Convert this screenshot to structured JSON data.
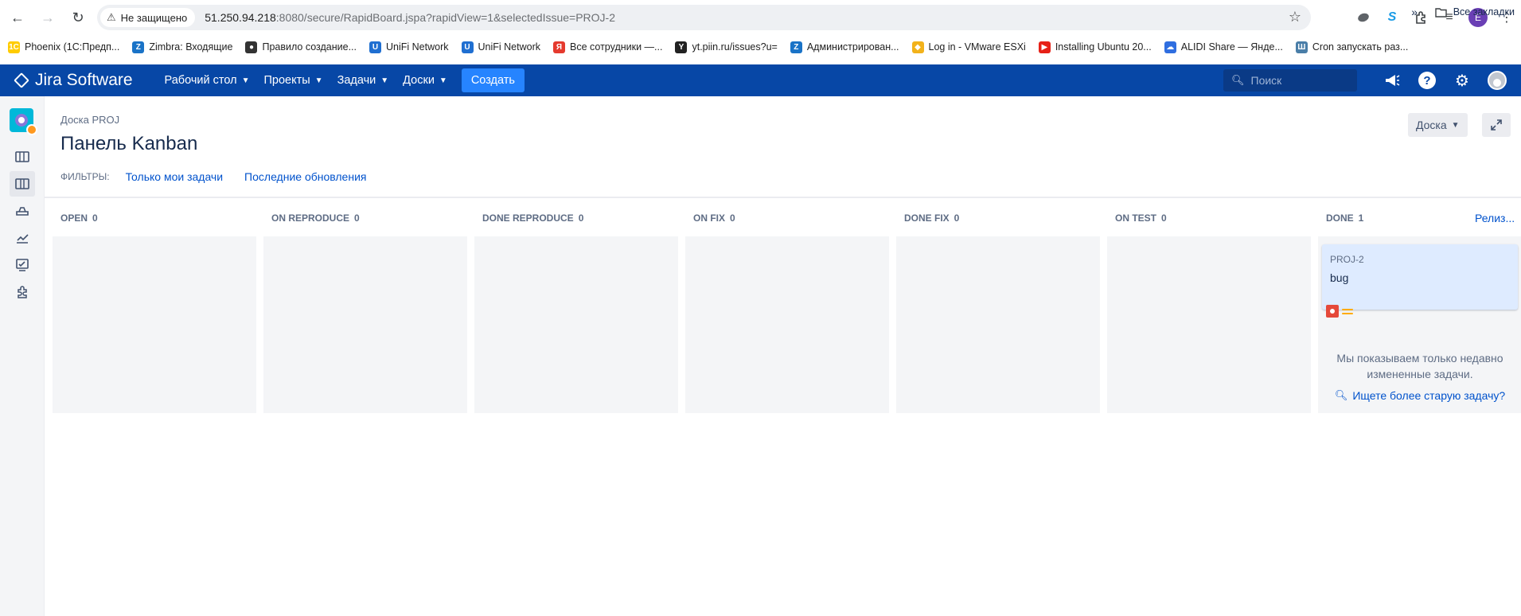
{
  "browser": {
    "security_label": "Не защищено",
    "url_host": "51.250.94.218",
    "url_rest": ":8080/secure/RapidBoard.jspa?rapidView=1&selectedIssue=PROJ-2",
    "profile_letter": "E"
  },
  "bookmarks": [
    {
      "label": "Phoenix (1С:Предп...",
      "icon": "1c-icon",
      "color": "#ffcc00",
      "glyph": "1С"
    },
    {
      "label": "Zimbra: Входящие",
      "icon": "zimbra-icon",
      "color": "#1a73c7",
      "glyph": "Z"
    },
    {
      "label": "Правило создание...",
      "icon": "globe-icon",
      "color": "#333333",
      "glyph": "●"
    },
    {
      "label": "UniFi Network",
      "icon": "unifi-icon",
      "color": "#1f6fd1",
      "glyph": "U"
    },
    {
      "label": "UniFi Network",
      "icon": "unifi-icon",
      "color": "#1f6fd1",
      "glyph": "U"
    },
    {
      "label": "Все сотрудники —...",
      "icon": "yandex-icon",
      "color": "#e53a2e",
      "glyph": "Я"
    },
    {
      "label": "yt.piin.ru/issues?u=",
      "icon": "youtrack-icon",
      "color": "#222222",
      "glyph": "Y"
    },
    {
      "label": "Администрирован...",
      "icon": "zimbra-icon",
      "color": "#1a73c7",
      "glyph": "Z"
    },
    {
      "label": "Log in - VMware ESXi",
      "icon": "vmware-icon",
      "color": "#f2b21b",
      "glyph": "◆"
    },
    {
      "label": "Installing Ubuntu 20...",
      "icon": "youtube-icon",
      "color": "#e62117",
      "glyph": "▶"
    },
    {
      "label": "ALIDI Share — Янде...",
      "icon": "cloud-icon",
      "color": "#2f6ee0",
      "glyph": "☁"
    },
    {
      "label": "Cron запускать раз...",
      "icon": "site-icon",
      "color": "#4a7ea8",
      "glyph": "Ш"
    }
  ],
  "bookmarks_all": "Все закладки",
  "jira": {
    "product": "Jira Software",
    "menu": [
      "Рабочий стол",
      "Проекты",
      "Задачи",
      "Доски"
    ],
    "create": "Создать",
    "search_placeholder": "Поиск"
  },
  "board": {
    "breadcrumb": "Доска PROJ",
    "title": "Панель Kanban",
    "board_menu": "Доска",
    "filters_label": "ФИЛЬТРЫ:",
    "filters": [
      "Только мои задачи",
      "Последние обновления"
    ],
    "release_link": "Релиз...",
    "columns": [
      {
        "name": "OPEN",
        "count": "0"
      },
      {
        "name": "ON REPRODUCE",
        "count": "0"
      },
      {
        "name": "DONE REPRODUCE",
        "count": "0"
      },
      {
        "name": "ON FIX",
        "count": "0"
      },
      {
        "name": "DONE FIX",
        "count": "0"
      },
      {
        "name": "ON TEST",
        "count": "0"
      },
      {
        "name": "DONE",
        "count": "1"
      }
    ],
    "card": {
      "key": "PROJ-2",
      "summary": "bug",
      "type_icon": "bug-icon",
      "priority_icon": "priority-medium-icon",
      "type_color": "#e5493a",
      "priority_color": "#ffab00"
    },
    "recent_note": "Мы показываем только недавно измененные задачи.",
    "older_link": "Ищете более старую задачу?"
  }
}
